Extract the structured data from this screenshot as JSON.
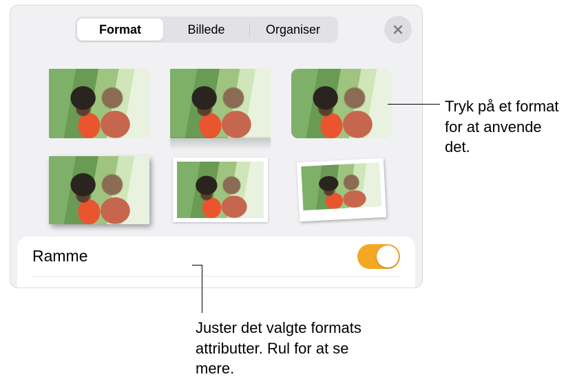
{
  "tabs": {
    "items": [
      {
        "label": "Format",
        "selected": true
      },
      {
        "label": "Billede",
        "selected": false
      },
      {
        "label": "Organiser",
        "selected": false
      }
    ]
  },
  "close_icon": "close-icon",
  "style_grid": {
    "variants": [
      "plain",
      "reflect",
      "rounded",
      "shadow",
      "whiteborder",
      "polaroid"
    ]
  },
  "frame_row": {
    "label": "Ramme",
    "toggle_on": true
  },
  "colors": {
    "accent": "#f5a623"
  },
  "callouts": {
    "top_right": "Tryk på et format for at anvende det.",
    "bottom": "Juster det valgte formats attributter. Rul for at se mere."
  }
}
